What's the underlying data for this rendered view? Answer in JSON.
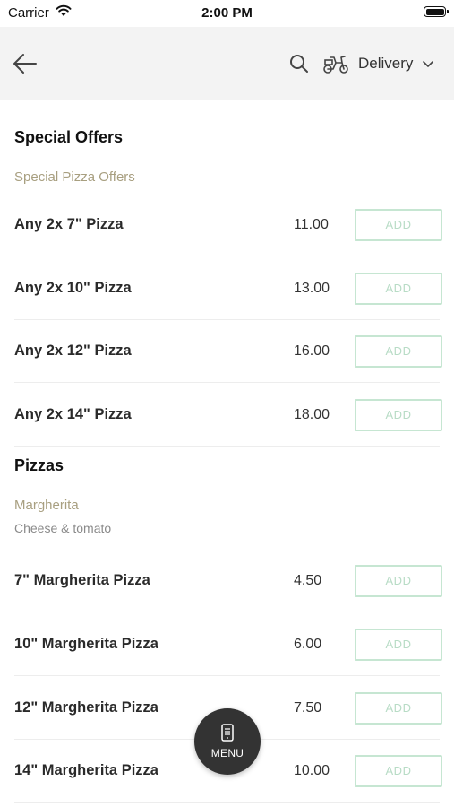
{
  "status_bar": {
    "carrier": "Carrier",
    "time": "2:00 PM"
  },
  "header": {
    "delivery_label": "Delivery"
  },
  "sections": [
    {
      "title": "Special Offers",
      "subtitle": "Special Pizza Offers",
      "items": [
        {
          "name": "Any 2x 7\" Pizza",
          "price": "11.00",
          "button": "ADD"
        },
        {
          "name": "Any 2x 10\" Pizza",
          "price": "13.00",
          "button": "ADD"
        },
        {
          "name": "Any 2x 12\" Pizza",
          "price": "16.00",
          "button": "ADD"
        },
        {
          "name": "Any 2x 14\" Pizza",
          "price": "18.00",
          "button": "ADD"
        }
      ]
    },
    {
      "title": "Pizzas",
      "subtitle": "Margherita",
      "description": "Cheese & tomato",
      "items": [
        {
          "name": "7\" Margherita Pizza",
          "price": "4.50",
          "button": "ADD"
        },
        {
          "name": "10\" Margherita Pizza",
          "price": "6.00",
          "button": "ADD"
        },
        {
          "name": "12\" Margherita Pizza",
          "price": "7.50",
          "button": "ADD"
        },
        {
          "name": "14\" Margherita Pizza",
          "price": "10.00",
          "button": "ADD"
        }
      ]
    }
  ],
  "menu_button": {
    "label": "MENU"
  },
  "colors": {
    "accent_green": "#c6e6d2",
    "subtitle_tan": "#a89f80",
    "fab": "#333333"
  },
  "icons": [
    "wifi-icon",
    "battery-icon",
    "back-arrow-icon",
    "search-icon",
    "scooter-icon",
    "chevron-down-icon",
    "phone-menu-icon"
  ]
}
